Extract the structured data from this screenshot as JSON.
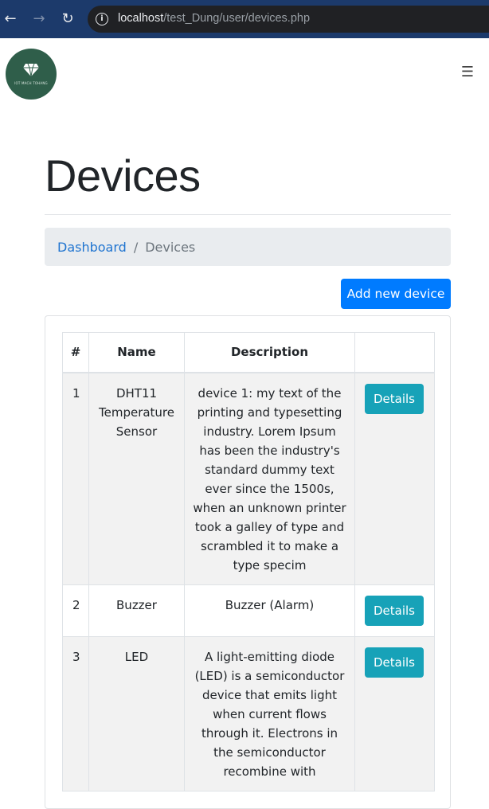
{
  "browser": {
    "url_host": "localhost",
    "url_path": "/test_Dung/user/devices.php"
  },
  "navbar": {
    "logo_text": "IOT MACH TOHANG",
    "menu_icon": "hamburger-icon"
  },
  "page": {
    "title": "Devices"
  },
  "breadcrumb": {
    "items": [
      {
        "label": "Dashboard"
      },
      {
        "label": "Devices"
      }
    ],
    "separator": "/"
  },
  "actions": {
    "add_label": "Add new device"
  },
  "table": {
    "headers": [
      "#",
      "Name",
      "Description",
      ""
    ],
    "rows": [
      {
        "num": "1",
        "name": "DHT11 Temperature Sensor",
        "description": "device 1: my text of the printing and typesetting industry. Lorem Ipsum has been the industry's standard dummy text ever since the 1500s, when an unknown printer took a galley of type and scrambled it to make a type specim",
        "action": "Details"
      },
      {
        "num": "2",
        "name": "Buzzer",
        "description": "Buzzer (Alarm)",
        "action": "Details"
      },
      {
        "num": "3",
        "name": "LED",
        "description": "A light-emitting diode (LED) is a semiconductor device that emits light when current flows through it. Electrons in the semiconductor recombine with",
        "action": "Details"
      }
    ]
  },
  "colors": {
    "primary": "#007bff",
    "info": "#17a2b8",
    "breadcrumb_bg": "#e9ecef",
    "browser_bar": "#1c3a6b"
  }
}
